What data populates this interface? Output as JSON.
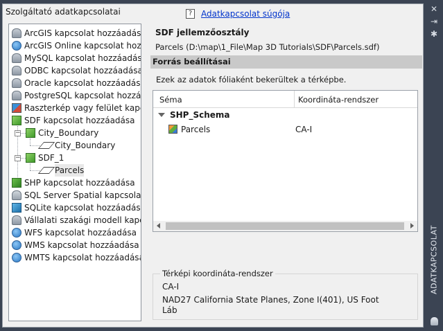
{
  "left_panel": {
    "title": "Szolgáltató adatkapcsolatai",
    "items": [
      {
        "label": "ArcGIS kapcsolat hozzáadása"
      },
      {
        "label": "ArcGIS Online kapcsolat hozzáadása"
      },
      {
        "label": "MySQL kapcsolat hozzáadása"
      },
      {
        "label": "ODBC kapcsolat hozzáadása"
      },
      {
        "label": "Oracle kapcsolat hozzáadása"
      },
      {
        "label": "PostgreSQL kapcsolat hozzáadása"
      },
      {
        "label": "Raszterkép vagy felület kapcsolat hozzáadása"
      },
      {
        "label": "SDF kapcsolat hozzáadása"
      },
      {
        "label": "City_Boundary"
      },
      {
        "label": "City_Boundary"
      },
      {
        "label": "SDF_1"
      },
      {
        "label": "Parcels"
      },
      {
        "label": "SHP kapcsolat hozzáadása"
      },
      {
        "label": "SQL Server Spatial kapcsolat hozzáadása"
      },
      {
        "label": "SQLite kapcsolat hozzáadása"
      },
      {
        "label": "Vállalati szakági modell kapcsolat hozzáadása"
      },
      {
        "label": "WFS kapcsolat hozzáadása"
      },
      {
        "label": "WMS kapcsolat hozzáadása"
      },
      {
        "label": "WMTS kapcsolat hozzáadása"
      }
    ]
  },
  "help": {
    "icon": "?",
    "link_label": "Adatkapcsolat súgója"
  },
  "feature_class": {
    "title": "SDF jellemzőosztály",
    "path": "Parcels (D:\\map\\1_File\\Map 3D Tutorials\\SDF\\Parcels.sdf)"
  },
  "source_settings": {
    "title": "Forrás beállításai",
    "info": "Ezek az adatok fóliaként bekerültek a térképbe.",
    "grid": {
      "columns": [
        "Séma",
        "Koordináta-rendszer"
      ],
      "schema": "SHP_Schema",
      "rows": [
        {
          "name": "Parcels",
          "crs": "CA-I"
        }
      ]
    }
  },
  "map_crs": {
    "label": "Térképi koordináta-rendszer",
    "code": "CA-I",
    "description": "NAD27 California State Planes, Zone I(401), US Foot",
    "unit": "Láb"
  },
  "side_strip": {
    "title": "ADATKAPCSOLAT",
    "close_glyph": "✕",
    "pin_glyph": "⇥",
    "settings_glyph": "✱"
  }
}
